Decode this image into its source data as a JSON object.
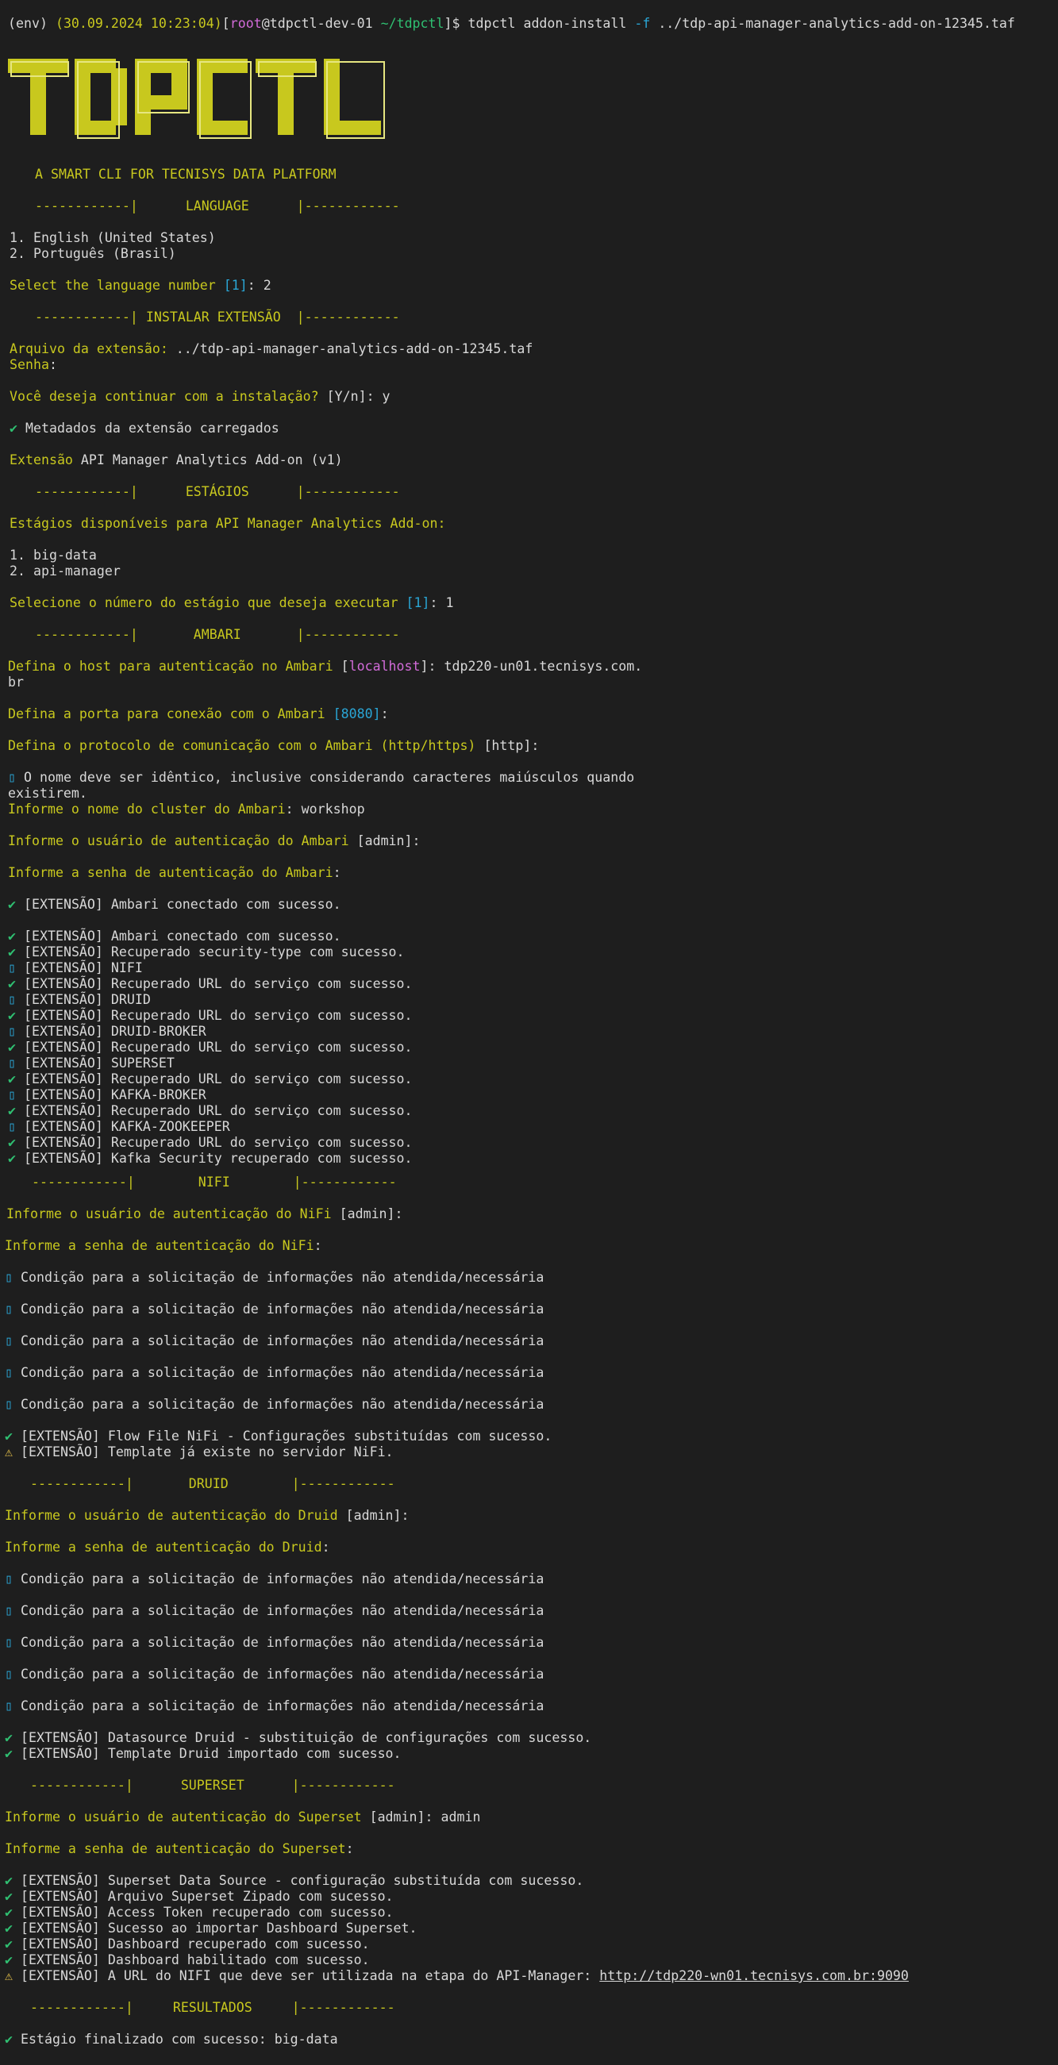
{
  "header": {
    "env": "(env)",
    "timestamp": "(30.09.2024 10:23:04)",
    "user": "root",
    "host": "@tdpctl-dev-01",
    "cwd": "~/tdpctl",
    "prompt_end": "]$",
    "command": "tdpctl addon-install",
    "flag": "-f",
    "file_arg": "../tdp-api-manager-analytics-add-on-12345.taf"
  },
  "logo": {
    "text": "TDPCTL",
    "tagline": "A SMART CLI FOR TECNISYS DATA PLATFORM",
    "color": "#c8c81e"
  },
  "sections": {
    "language": "------------|      LANGUAGE      |------------",
    "instalar": "------------| INSTALAR EXTENSÃO  |------------",
    "estagios": "------------|      ESTÁGIOS      |------------",
    "ambari": "------------|       AMBARI       |------------",
    "nifi": "------------|        NIFI        |------------",
    "druid": "------------|       DRUID        |------------",
    "superset": "------------|      SUPERSET      |------------",
    "resultados": "------------|     RESULTADOS     |------------"
  },
  "language": {
    "options": [
      "1. English (United States)",
      "2. Português (Brasil)"
    ],
    "prompt": "Select the language number",
    "default": "[1]",
    "answer": ": 2"
  },
  "install": {
    "file_label": "Arquivo da extensão:",
    "file_value": " ../tdp-api-manager-analytics-add-on-12345.taf",
    "password_label": "Senha",
    "confirm_prompt": "Você deseja continuar com a instalação?",
    "confirm_options": " [Y/n]",
    "confirm_answer": ": y",
    "metadata_ok": "Metadados da extensão carregados",
    "ext_label": "Extensão",
    "ext_value": " API Manager Analytics Add-on (v1)"
  },
  "stages": {
    "title": "Estágios disponíveis para API Manager Analytics Add-on:",
    "options": [
      "1. big-data",
      "2. api-manager"
    ],
    "prompt": "Selecione o número do estágio que deseja executar",
    "default": "[1]",
    "answer": ": 1"
  },
  "ambari": {
    "host_prompt": "Defina o host para autenticação no Ambari",
    "host_default": "localhost",
    "host_answer": "tdp220-un01.tecnisys.com.",
    "host_answer_wrap": "br",
    "port_prompt": "Defina a porta para conexão com o Ambari",
    "port_default": "[8080]",
    "proto_prompt": "Defina o protocolo de comunicação com o Ambari (http/https)",
    "proto_default": "[http]",
    "note_line1": " O nome deve ser idêntico, inclusive considerando caracteres maiúsculos quando",
    "note_line2": "existirem.",
    "cluster_prompt": "Informe o nome do cluster do Ambari",
    "cluster_answer": "workshop",
    "user_prompt": "Informe o usuário de autenticação do Ambari",
    "user_default": "[admin]",
    "pass_prompt": "Informe a senha de autenticação do Ambari",
    "connected": "[EXTENSÃO] Ambari conectado com sucesso.",
    "log": [
      "[EXTENSÃO] Ambari conectado com sucesso.",
      "[EXTENSÃO] Recuperado security-type com sucesso.",
      "[EXTENSÃO] NIFI",
      "[EXTENSÃO] Recuperado URL do serviço com sucesso.",
      "[EXTENSÃO] DRUID",
      "[EXTENSÃO] Recuperado URL do serviço com sucesso.",
      "[EXTENSÃO] DRUID-BROKER",
      "[EXTENSÃO] Recuperado URL do serviço com sucesso.",
      "[EXTENSÃO] SUPERSET",
      "[EXTENSÃO] Recuperado URL do serviço com sucesso.",
      "[EXTENSÃO] KAFKA-BROKER",
      "[EXTENSÃO] Recuperado URL do serviço com sucesso.",
      "[EXTENSÃO] KAFKA-ZOOKEEPER",
      "[EXTENSÃO] Recuperado URL do serviço com sucesso.",
      "[EXTENSÃO] Kafka Security recuperado com sucesso."
    ]
  },
  "nifi": {
    "user_prompt": "Informe o usuário de autenticação do NiFi",
    "user_default": "[admin]",
    "pass_prompt": "Informe a senha de autenticação do NiFi",
    "condition": "Condição para a solicitação de informações não atendida/necessária",
    "flow_ok": "[EXTENSÃO] Flow File NiFi - Configurações substituídas com sucesso.",
    "template_warn": "[EXTENSÃO] Template já existe no servidor NiFi."
  },
  "druid": {
    "user_prompt": "Informe o usuário de autenticação do Druid",
    "user_default": "[admin]",
    "pass_prompt": "Informe a senha de autenticação do Druid",
    "condition": "Condição para a solicitação de informações não atendida/necessária",
    "log": [
      "[EXTENSÃO] Datasource Druid - substituição de configurações com sucesso.",
      "[EXTENSÃO] Template Druid importado com sucesso."
    ]
  },
  "superset": {
    "user_prompt": "Informe o usuário de autenticação do Superset",
    "user_default": "[admin]",
    "user_answer": ": admin",
    "pass_prompt": "Informe a senha de autenticação do Superset",
    "log": [
      "[EXTENSÃO] Superset Data Source - configuração substituída com sucesso.",
      "[EXTENSÃO] Arquivo Superset Zipado com sucesso.",
      "[EXTENSÃO] Access Token recuperado com sucesso.",
      "[EXTENSÃO] Sucesso ao importar Dashboard Superset.",
      "[EXTENSÃO] Dashboard recuperado com sucesso.",
      "[EXTENSÃO] Dashboard habilitado com sucesso."
    ],
    "url_warn": "[EXTENSÃO] A URL do NIFI que deve ser utilizada na etapa do API-Manager: ",
    "url": "http://tdp220-wn01.tecnisys.com.br:9090"
  },
  "result": {
    "text": "Estágio finalizado com sucesso: big-data"
  },
  "symbols": {
    "ok": "✔",
    "warn": "⚠",
    "info": "▯"
  }
}
